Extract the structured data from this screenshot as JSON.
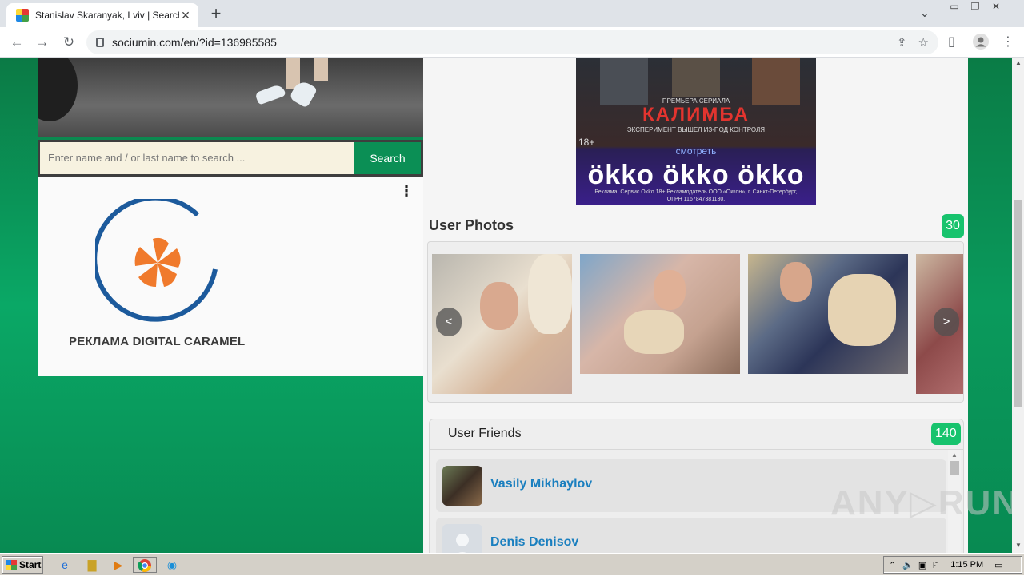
{
  "browser": {
    "tab_title": "Stanislav Skaranyak, Lviv | Search In",
    "tab_close": "✕",
    "new_tab": "+",
    "url": "sociumin.com/en/?id=136985585",
    "window_controls": [
      "▭",
      "❐",
      "✕"
    ]
  },
  "page": {
    "search": {
      "placeholder": "Enter name and / or last name to search ...",
      "button": "Search"
    },
    "ad": {
      "menu": "⋮",
      "text": "РЕКЛАМА DIGITAL CARAMEL"
    },
    "okko_banner": {
      "premiere": "ПРЕМЬЕРА СЕРИАЛА",
      "title": "КАЛИМБА",
      "tagline": "ЭКСПЕРИМЕНТ ВЫШЕЛ ИЗ-ПОД КОНТРОЛЯ",
      "age": "18+",
      "watch": "смотреть",
      "brand": "ökko ökko ökko",
      "legal": "Реклама. Сервис Okko 18+ Рекламодатель ООО «Оккон», г. Санкт-Петербург, ОГРН 1167847381130."
    },
    "user_photos": {
      "title": "User Photos",
      "count": "30",
      "prev": "<",
      "next": ">"
    },
    "user_friends": {
      "title": "User Friends",
      "count": "140",
      "items": [
        {
          "name": "Vasily Mikhaylov"
        },
        {
          "name": "Denis Denisov"
        }
      ]
    }
  },
  "watermark": "ANY▷RUN",
  "taskbar": {
    "start": "Start",
    "time": "1:15 PM"
  },
  "colors": {
    "accent_green": "#17c36d",
    "search_button": "#0b8f55",
    "link_blue": "#1a7fbf"
  }
}
